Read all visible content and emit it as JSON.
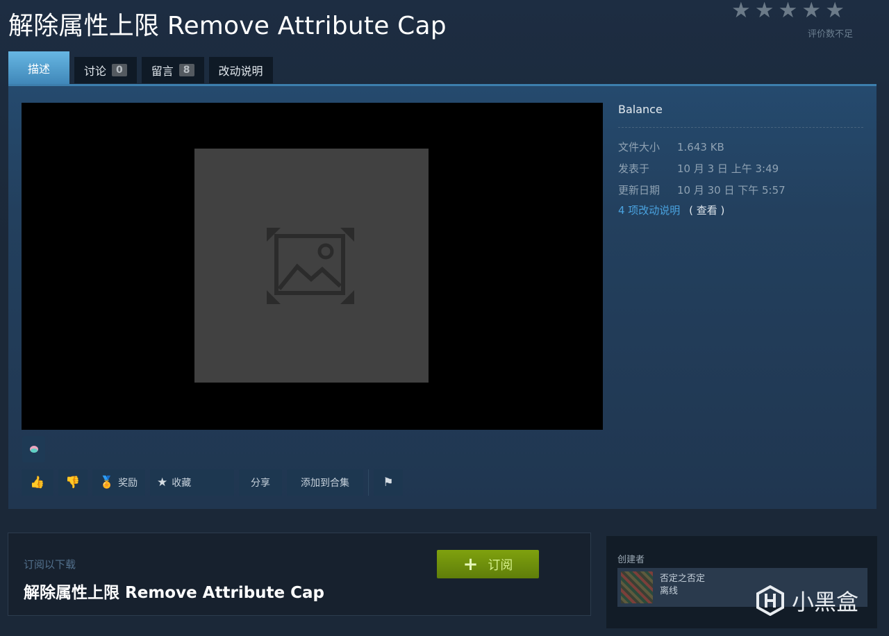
{
  "header": {
    "title": "解除属性上限 Remove Attribute Cap",
    "rating_text": "评价数不足"
  },
  "tabs": [
    {
      "label": "描述"
    },
    {
      "label": "讨论",
      "count": "0"
    },
    {
      "label": "留言",
      "count": "8"
    },
    {
      "label": "改动说明"
    }
  ],
  "actions": {
    "award": "奖励",
    "favorite": "收藏",
    "share": "分享",
    "add_collection": "添加到合集"
  },
  "info": {
    "type": "Balance",
    "file_size_label": "文件大小",
    "file_size": "1.643 KB",
    "posted_label": "发表于",
    "posted": "10 月 3 日 上午 3:49",
    "updated_label": "更新日期",
    "updated": "10 月 30 日 下午 5:57",
    "changes_link": "4 项改动说明",
    "view_link": "( 查看 )"
  },
  "subscribe": {
    "label": "订阅以下载",
    "title": "解除属性上限 Remove Attribute Cap",
    "button": "订阅"
  },
  "creator": {
    "label": "创建者",
    "name": "否定之否定",
    "status": "离线"
  },
  "watermark": "小黑盒",
  "colors": {
    "accent_tab": "#67b7e3",
    "subscribe_green": "#7fa10e",
    "link_blue": "#4aa3e0"
  }
}
